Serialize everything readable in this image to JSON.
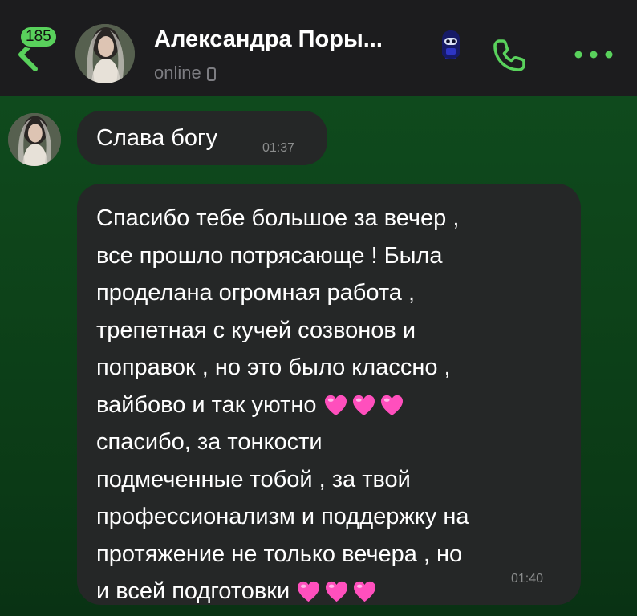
{
  "header": {
    "unread_count": "185",
    "contact_name": "Александра Поры...",
    "status": "online"
  },
  "messages": [
    {
      "text": "Слава богу",
      "time": "01:37",
      "lines": []
    },
    {
      "lines": [
        "Спасибо тебе большое за вечер ,",
        "все прошло потрясающе ! Была",
        "проделана огромная работа ,",
        "трепетная с кучей созвонов и",
        "поправок , но это было классно ,",
        "вайбово и так уютно",
        "спасибо, за тонкости",
        "подмеченные тобой , за твой",
        "профессионализм и поддержку на",
        "протяжение не только вечера , но",
        "и всей подготовки"
      ],
      "time": "01:40"
    }
  ],
  "icons": {
    "back": "back-arrow-icon",
    "call": "phone-icon",
    "more": "more-dots-icon",
    "device": "phone-device-icon",
    "emoji_status": "ninja-emoji-icon",
    "heart": "pink-heart-emoji"
  },
  "colors": {
    "accent": "#59d15c",
    "header_bg": "#1c1c1e",
    "bubble_bg": "#252727",
    "chat_bg_top": "#0f4a1d",
    "chat_bg_bottom": "#093214",
    "heart": "#ff4fbd",
    "muted_text": "#7d7d82"
  }
}
